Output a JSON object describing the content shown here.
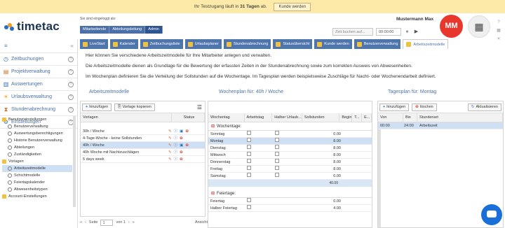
{
  "banner": {
    "prefix": "Ihr Testzugang läuft in",
    "days": "31 Tagen",
    "suffix": "ab.",
    "button": "Kunde werden"
  },
  "logo": {
    "text": "timetac"
  },
  "login": {
    "label": "Sie sind eingeloggt als:",
    "roles": [
      "Mitarbeitende",
      "Abteilungsleitung",
      "Admin"
    ]
  },
  "user": {
    "name": "Mustermann Max",
    "initials": "MM"
  },
  "controls": {
    "search_placeholder": "Zeit buchen auf...",
    "time": "00:00:00"
  },
  "tabs": [
    "LiveStart",
    "Kalender",
    "Zeitbuchungsliste",
    "Urlaubsplaner",
    "Stundenabrechnung",
    "Statusübersicht",
    "Kunde werden",
    "Benutzerverwaltung",
    "Arbeitszeitmodelle"
  ],
  "sidebar": {
    "items": [
      "Zeitbuchungen",
      "Projektverwaltung",
      "Auswertungen",
      "Urlaubsverwaltung",
      "Stundenabrechnung",
      "Einstellungen"
    ],
    "tree": [
      "Benutzereinstellungen",
      "Benutzerverwaltung",
      "Auswertungsberechtigungen",
      "Historie Benutzerverwaltung",
      "Abteilungen",
      "Zuständigkeiten",
      "Vorlagen",
      "Arbeitszeitmodelle",
      "Schichtmodelle",
      "Feiertagskalender",
      "Abwesenheitstypen",
      "Account-Einstellungen"
    ]
  },
  "intro": [
    "Hier können Sie verschiedene Arbeitszeitmodelle für Ihre Mitarbeiter anlegen und verwalten.",
    "Die Arbeitszeitmodelle dienen als Grundlage für die Bewertung der erfassten Zeiten in der Stundenabrechnung sowie zum korrekten Ausweis von Abwesenheiten.",
    "Im Wochenplan definieren Sie die Verteilung der Sollstunden auf die Wochentage. Im Tagesplan werden beispielsweise Zuschläge für Nacht- oder Wochenendarbeit definiert."
  ],
  "sections": {
    "models": "Arbeitszeitmodelle",
    "week": "Wochenplan für: 40h / Woche",
    "day": "Tagesplan für: Montag"
  },
  "models": {
    "add": "hinzufügen",
    "copy": "Vorlage kopieren",
    "headers": [
      "Vorlagen",
      "Status"
    ],
    "rows": [
      "30h / Woche",
      "4-Tage-Woche - keine Sollstunden",
      "40h / Woche",
      "40h Woche mit Nachtzuschlägen",
      "5 days week"
    ],
    "pager": {
      "page": "Seite",
      "current": "1",
      "of": "von 1",
      "view": "Ansicht"
    }
  },
  "week": {
    "headers": [
      "Wochentag",
      "Arbeitstag",
      "Halber Urlaub...",
      "Sollstunden",
      "Beginn",
      "T...",
      "E..."
    ],
    "group1": "Wochentage:",
    "days": [
      {
        "day": "Sonntag",
        "hours": "0.00"
      },
      {
        "day": "Montag",
        "hours": "8.00"
      },
      {
        "day": "Dienstag",
        "hours": "8.00"
      },
      {
        "day": "Mittwoch",
        "hours": "8.00"
      },
      {
        "day": "Donnerstag",
        "hours": "8.00"
      },
      {
        "day": "Freitag",
        "hours": "8.00"
      },
      {
        "day": "Samstag",
        "hours": "0.00"
      }
    ],
    "total": "40.00",
    "group2": "Feiertage:",
    "holidays": [
      {
        "day": "Feiertag",
        "hours": "0.00"
      },
      {
        "day": "Halber Feiertag",
        "hours": "4.00"
      }
    ]
  },
  "day": {
    "add": "hinzufügen",
    "delete": "löschen",
    "refresh": "Aktualisieren",
    "headers": [
      "Von",
      "Bis",
      "Stundenart"
    ],
    "rows": [
      {
        "from": "00:00",
        "to": "24:00",
        "type": "Arbeitszeit"
      }
    ]
  }
}
